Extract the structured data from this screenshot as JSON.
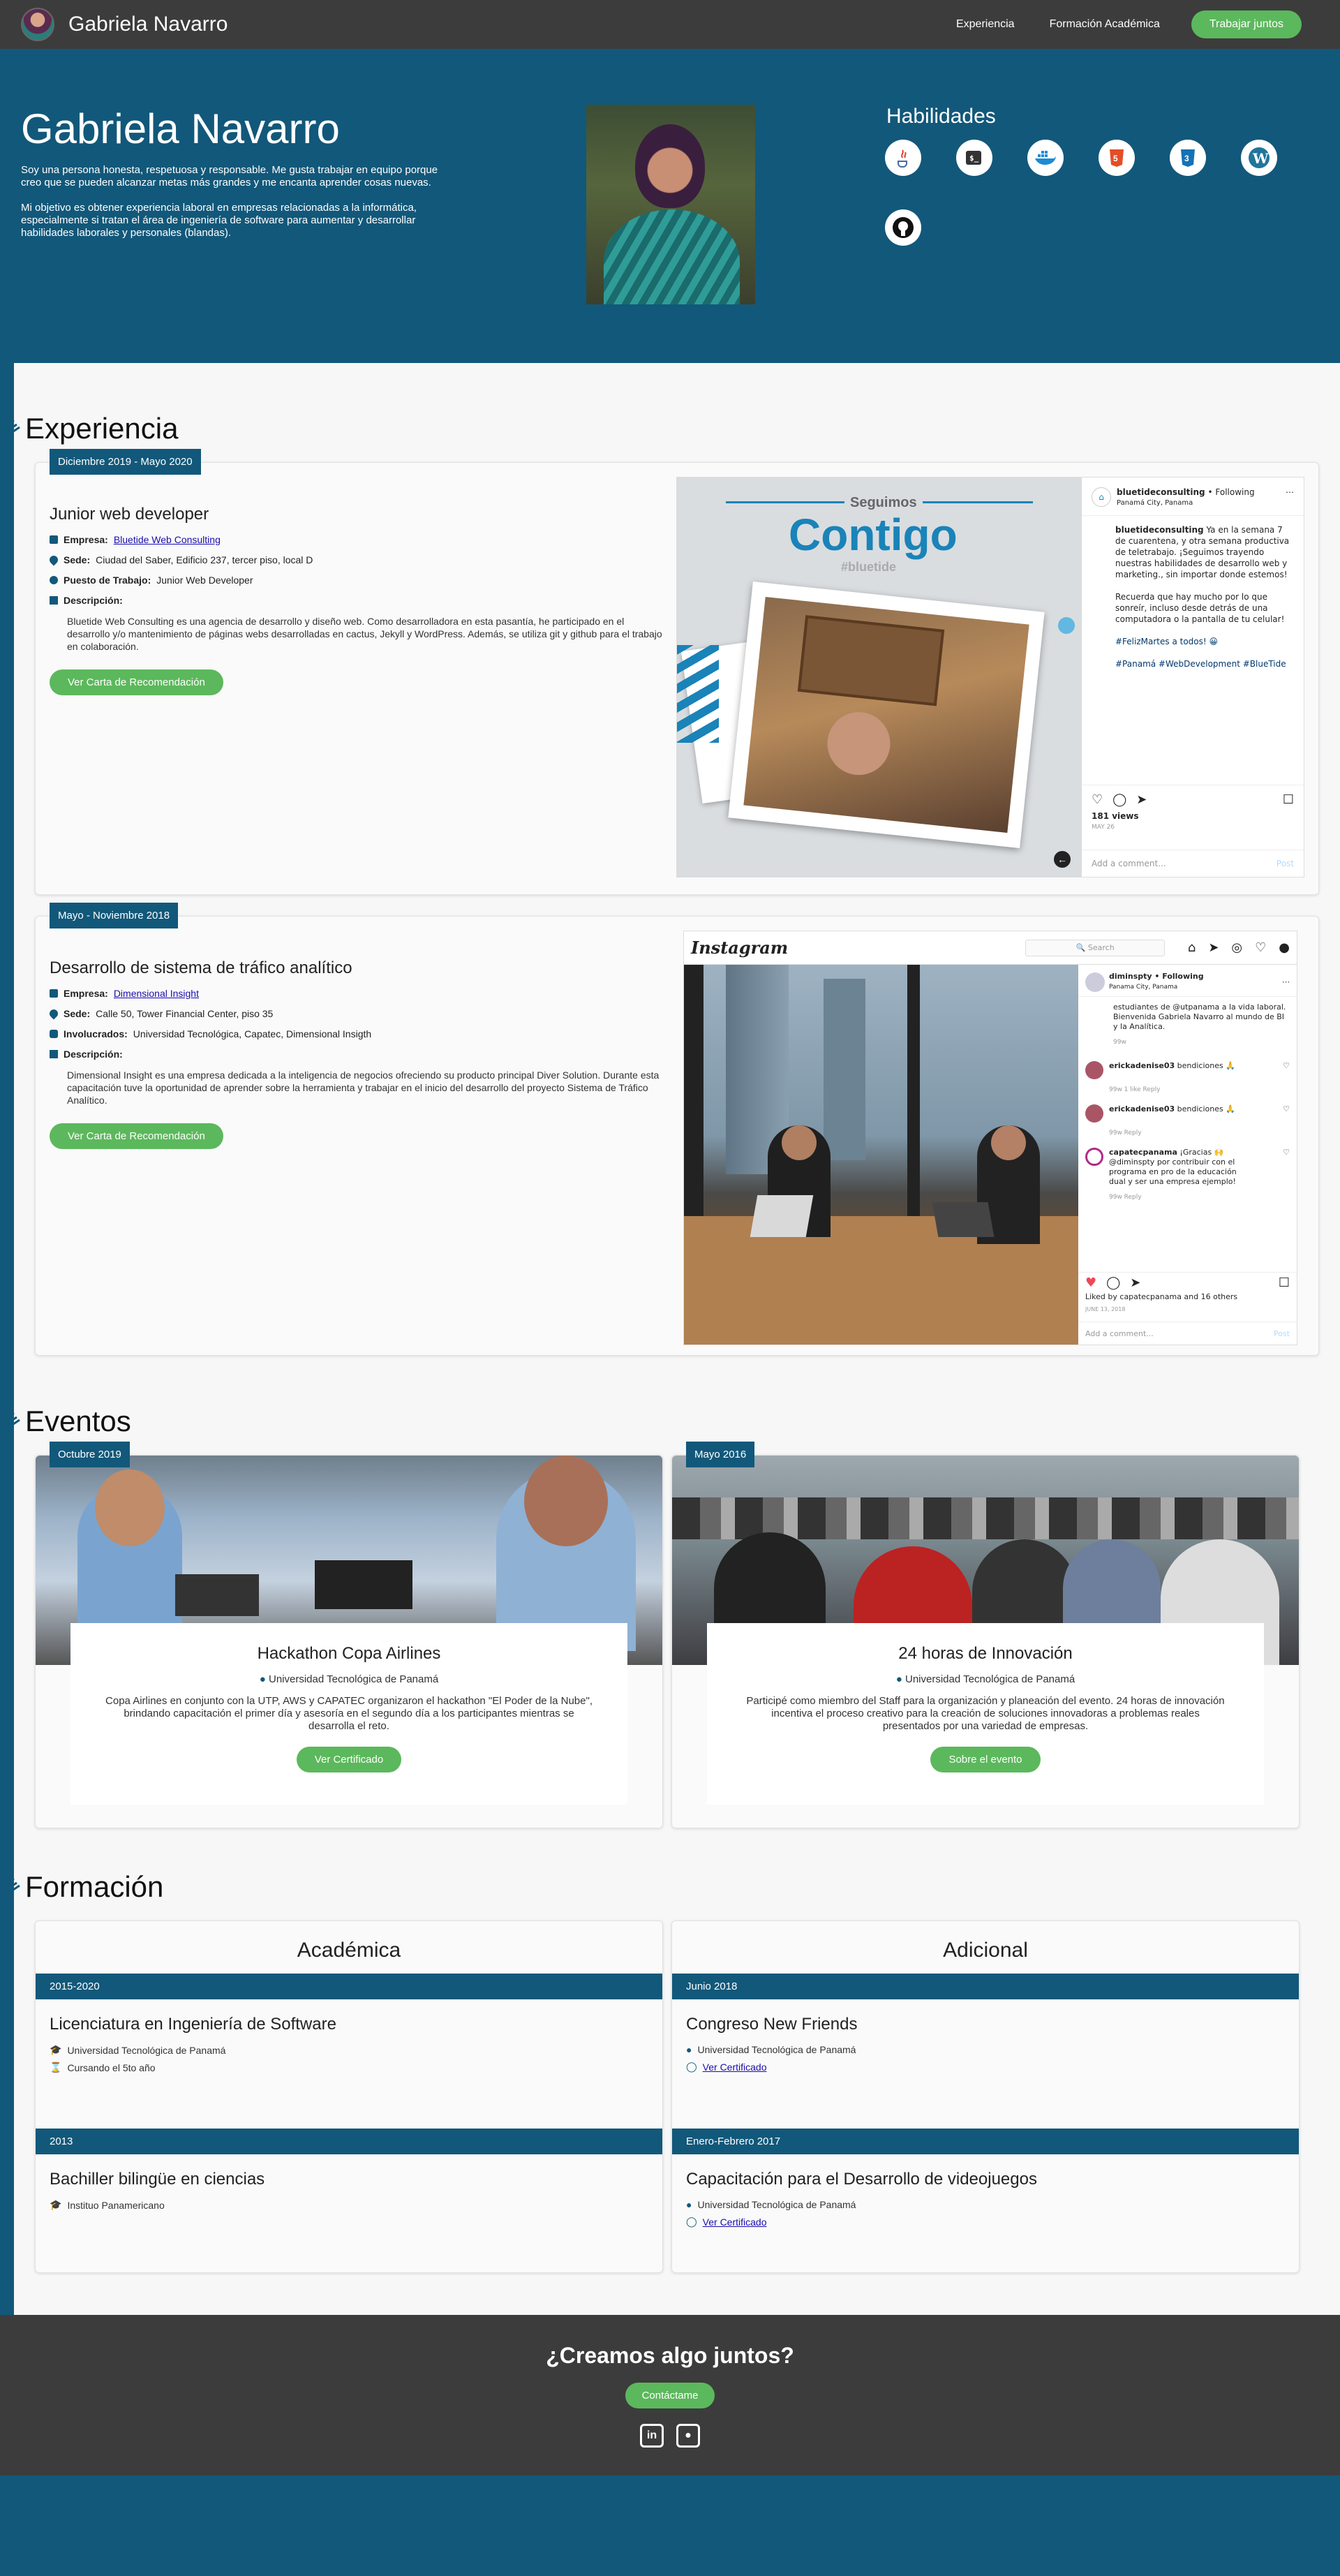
{
  "nav": {
    "brand": "Gabriela Navarro",
    "links": [
      "Experiencia",
      "Formación Académica"
    ],
    "cta": "Trabajar juntos"
  },
  "hero": {
    "name": "Gabriela Navarro",
    "bio1": "Soy una persona honesta, respetuosa y responsable. Me gusta trabajar en equipo porque creo que se pueden alcanzar metas más grandes y me encanta aprender cosas nuevas.",
    "bio2": "Mi objetivo es obtener experiencia laboral en empresas relacionadas a la informática, especialmente si tratan el área de ingeniería de software para aumentar y desarrollar habilidades laborales y personales (blandas).",
    "skills_title": "Habilidades",
    "skills": [
      {
        "label": "Java",
        "icon": "java-icon",
        "color": "#e23e2b"
      },
      {
        "label": "Shell",
        "icon": "shell-icon",
        "color": "#333333"
      },
      {
        "label": "Docker",
        "icon": "docker-icon",
        "color": "#1d8bd1"
      },
      {
        "label": "HTML5",
        "icon": "html5-icon",
        "color": "#e44d26"
      },
      {
        "label": "CSS3",
        "icon": "css3-icon",
        "color": "#1572b6"
      },
      {
        "label": "WordPress",
        "icon": "wordpress-icon",
        "color": "#21759b"
      },
      {
        "label": "GitHub",
        "icon": "github-icon",
        "color": "#111111"
      }
    ]
  },
  "sections": {
    "experience": "Experiencia",
    "events": "Eventos",
    "education": "Formación"
  },
  "experience": [
    {
      "date": "Diciembre 2019 - Mayo 2020",
      "title": "Junior web developer",
      "company_label": "Empresa:",
      "company": "Bluetide Web Consulting",
      "site_label": "Sede:",
      "site": "Ciudad del Saber, Edificio 237, tercer piso, local D",
      "role_label": "Puesto de Trabajo:",
      "role": "Junior Web Developer",
      "desc_label": "Descripción:",
      "desc": "Bluetide Web Consulting es una agencia de desarrollo y diseño web. Como desarrolladora en esta pasantía, he participado en el desarrollo y/o mantenimiento de páginas webs desarrolladas en cactus, Jekyll y WordPress. Además, se utiliza git y github para el trabajo en colaboración.",
      "button": "Ver Carta de Recomendación",
      "post": {
        "user": "bluetideconsulting",
        "follow": "• Following",
        "location": "Panamá City, Panama",
        "headline_small": "Seguimos",
        "headline": "Contigo",
        "hashtag": "#bluetide",
        "caption": "Ya en la semana 7 de cuarentena, y otra semana productiva de teletrabajo. ¡Seguimos trayendo nuestras habilidades de desarrollo web y marketing., sin importar donde estemos!",
        "caption2": "Recuerda que hay mucho por lo que sonreír, incluso desde detrás de una computadora o la pantalla de tu celular!",
        "caption3": "#FelizMartes a todos! 😀",
        "tags": "#Panamá #WebDevelopment #BlueTide",
        "views": "181 views",
        "age": "MAY 26",
        "comment": "Add a comment...",
        "post_btn": "Post"
      }
    },
    {
      "date": "Mayo - Noviembre 2018",
      "title": "Desarrollo de sistema de tráfico analítico",
      "company_label": "Empresa:",
      "company": "Dimensional Insight",
      "site_label": "Sede:",
      "site": "Calle 50, Tower Financial Center, piso 35",
      "role_label": "Involucrados:",
      "role": "Universidad Tecnológica, Capatec, Dimensional Insigth",
      "desc_label": "Descripción:",
      "desc": "Dimensional Insight es una empresa dedicada a la inteligencia de negocios ofreciendo su producto principal Diver Solution. Durante esta capacitación tuve la oportunidad de aprender sobre la herramienta y trabajar en el inicio del desarrollo del proyecto Sistema de Tráfico Analítico.",
      "button": "Ver Carta de Recomendación",
      "post": {
        "app": "Instagram",
        "search": "Search",
        "user": "diminspty • Following",
        "location": "Panama City, Panama",
        "c1": "estudiantes de @utpanama a la vida laboral. Bienvenida Gabriela Navarro al mundo de BI y la Analítica.",
        "c1_time": "99w",
        "c2_user": "erickadenise03",
        "c2": "bendiciones 🙏",
        "c2_time": "99w  1 like  Reply",
        "c3_user": "erickadenise03",
        "c3": "bendiciones 🙏",
        "c3_time": "99w  Reply",
        "c4_user": "capatecpanama",
        "c4": "¡Gracias 🙌 @diminspty por contribuir con el programa en pro de la educación dual y ser una empresa ejemplo!",
        "c4_time": "99w  Reply",
        "likes": "Liked by capatecpanama and 16 others",
        "age": "JUNE 13, 2018",
        "comment": "Add a comment...",
        "post_btn": "Post"
      }
    }
  ],
  "events": [
    {
      "date": "Octubre 2019",
      "title": "Hackathon Copa Airlines",
      "location": "Universidad Tecnológica de Panamá",
      "desc": "Copa Airlines en conjunto con la UTP, AWS y CAPATEC organizaron el hackathon \"El Poder de la Nube\", brindando capacitación el primer día y asesoría en el segundo día a los participantes mientras se desarrolla el reto.",
      "button": "Ver Certificado"
    },
    {
      "date": "Mayo 2016",
      "title": "24 horas de Innovación",
      "location": "Universidad Tecnológica de Panamá",
      "desc": "Participé como miembro del Staff para la organización y planeación del evento. 24 horas de innovación incentiva el proceso creativo para la creación de soluciones innovadoras a problemas reales presentados por una variedad de empresas.",
      "button": "Sobre el evento"
    }
  ],
  "education": {
    "academic": {
      "title": "Académica",
      "items": [
        {
          "date": "2015-2020",
          "title": "Licenciatura en Ingeniería de Software",
          "place": "Universidad Tecnológica de Panamá",
          "extra": "Cursando el 5to año"
        },
        {
          "date": "2013",
          "title": "Bachiller bilingüe en ciencias",
          "place": "Instituo Panamericano"
        }
      ]
    },
    "additional": {
      "title": "Adicional",
      "items": [
        {
          "date": "Junio 2018",
          "title": "Congreso New Friends",
          "place": "Universidad Tecnológica de Panamá",
          "link": "Ver Certificado"
        },
        {
          "date": "Enero-Febrero 2017",
          "title": "Capacitación para el Desarrollo de videojuegos",
          "place": "Universidad Tecnológica de Panamá",
          "link": "Ver Certificado"
        }
      ]
    }
  },
  "footer": {
    "title": "¿Creamos algo juntos?",
    "button": "Contáctame",
    "icons": [
      "linkedin-icon",
      "github-icon"
    ]
  }
}
